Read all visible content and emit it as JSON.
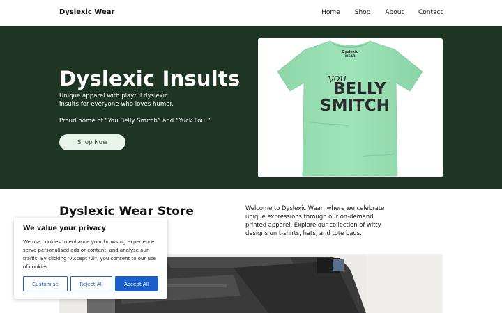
{
  "header": {
    "brand": "Dyslexic Wear",
    "nav": [
      {
        "label": "Home"
      },
      {
        "label": "Shop"
      },
      {
        "label": "About"
      },
      {
        "label": "Contact"
      }
    ]
  },
  "hero": {
    "title": "Dyslexic Insults",
    "description": "Unique apparel with playful dyslexic insults for everyone who loves humor.",
    "note": "Proud home of “You Belly Smitch” and “Yuck Fou!”",
    "button_label": "Shop Now",
    "shirt": {
      "tag_line1": "Dyslexic",
      "tag_line2": "WEAR",
      "word_you": "you",
      "word_belly": "BELLY",
      "word_smitch": "SMITCH"
    }
  },
  "store": {
    "title": "Dyslexic Wear Store",
    "description": "Welcome to Dyslexic Wear, where we celebrate unique expressions through our on-demand printed apparel. Explore our collection of witty designs on t-shirts, hats, and tote bags."
  },
  "cookie": {
    "title": "We value your privacy",
    "text": "We use cookies to enhance your browsing experience, serve personalised ads or content, and analyse our traffic. By clicking \"Accept All\", you consent to our use of cookies.",
    "customise_label": "Customise",
    "reject_label": "Reject All",
    "accept_label": "Accept All"
  },
  "colors": {
    "hero_bg": "#1e3524",
    "shirt": "#97dfb2",
    "accent_blue": "#1a5fc8"
  }
}
